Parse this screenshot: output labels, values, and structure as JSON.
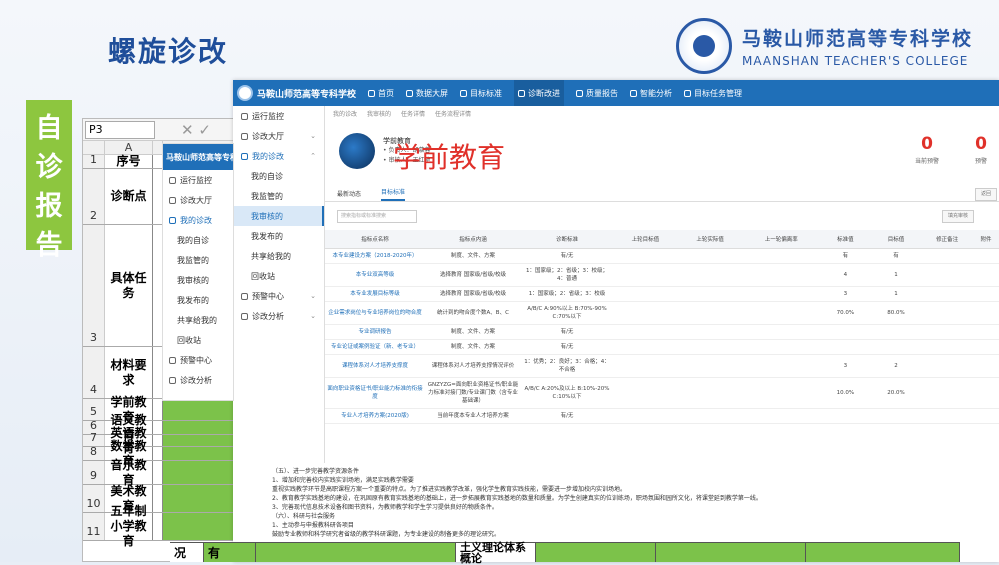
{
  "slide": {
    "title": "螺旋诊改",
    "side_tab": [
      "自",
      "诊",
      "报",
      "告"
    ],
    "college_cn": "马鞍山师范高等专科学校",
    "college_en": "MAANSHAN TEACHER'S COLLEGE"
  },
  "spreadsheet": {
    "cell_ref": "P3",
    "icons": "✕ ✓",
    "col_a": "A",
    "rows": [
      {
        "n": "1",
        "a": "序号",
        "h": 14
      },
      {
        "n": "2",
        "a": "诊断点",
        "h": 56
      },
      {
        "n": "3",
        "a": "具体任务",
        "h": 122
      },
      {
        "n": "4",
        "a": "材料要求",
        "h": 52
      },
      {
        "n": "5",
        "a": "学前教育",
        "h": 22
      },
      {
        "n": "6",
        "a": "语文教育",
        "h": 14
      },
      {
        "n": "7",
        "a": "英语教育",
        "h": 12
      },
      {
        "n": "8",
        "a": "数学教育",
        "h": 14
      },
      {
        "n": "9",
        "a": "音乐教育",
        "h": 24
      },
      {
        "n": "10",
        "a": "美术教育",
        "h": 28
      },
      {
        "n": "11",
        "a": "五年制小学教育",
        "h": 28
      }
    ]
  },
  "app": {
    "brand": "马鞍山师范高等专科学校",
    "nav": [
      "首页",
      "数据大屏",
      "目标标准",
      "诊断改进",
      "质量报告",
      "智能分析",
      "目标任务管理"
    ],
    "nav_active": 3,
    "menu": [
      {
        "type": "item",
        "label": "运行监控",
        "caret": ""
      },
      {
        "type": "item",
        "label": "诊改大厅",
        "caret": "⌄"
      },
      {
        "type": "item",
        "label": "我的诊改",
        "caret": "⌃",
        "open": true
      },
      {
        "type": "sub",
        "label": "我的自诊"
      },
      {
        "type": "sub",
        "label": "我监管的"
      },
      {
        "type": "sub",
        "label": "我审核的",
        "sel": true
      },
      {
        "type": "sub",
        "label": "我发布的"
      },
      {
        "type": "sub",
        "label": "共享给我的"
      },
      {
        "type": "sub",
        "label": "回收站"
      },
      {
        "type": "item",
        "label": "预警中心",
        "caret": "⌄"
      },
      {
        "type": "item",
        "label": "诊改分析",
        "caret": "⌄"
      }
    ],
    "overlay_menu": [
      {
        "type": "item",
        "label": "运行监控"
      },
      {
        "type": "item",
        "label": "诊改大厅"
      },
      {
        "type": "item",
        "label": "我的诊改",
        "open": true
      },
      {
        "type": "sub",
        "label": "我的自诊"
      },
      {
        "type": "sub",
        "label": "我监管的"
      },
      {
        "type": "sub",
        "label": "我审核的"
      },
      {
        "type": "sub",
        "label": "我发布的"
      },
      {
        "type": "sub",
        "label": "共享给我的"
      },
      {
        "type": "sub",
        "label": "回收站"
      },
      {
        "type": "item",
        "label": "预警中心"
      },
      {
        "type": "item",
        "label": "诊改分析"
      }
    ],
    "breadcrumb": [
      "我的诊改",
      "我审核的",
      "任务详情",
      "任务流程详情"
    ],
    "profile": {
      "name": "学前教育",
      "owner": "• 负责人：胡慕蓉",
      "reviewer": "• 审核人：王红艳"
    },
    "big_title": "学前教育",
    "counters": [
      {
        "num": "0",
        "label": "当前预警"
      },
      {
        "num": "0",
        "label": "预警"
      }
    ],
    "tabs": [
      "最新动态",
      "目标标准"
    ],
    "tab_active": 1,
    "search_placeholder": "搜索指标或标准搜索",
    "btn_export": "填充审核",
    "btn_back": "返回",
    "table": {
      "headers": [
        "指标点名称",
        "指标点内涵",
        "诊断标准",
        "上轮目标值",
        "上轮实际值",
        "上一轮偏离率",
        "标准值",
        "目标值",
        "修正备注",
        "附件"
      ],
      "rows": [
        [
          "本专业建设方案（2018-2020年）",
          "制度、文件、方案",
          "有/无",
          "",
          "",
          "",
          "有",
          "有",
          "",
          ""
        ],
        [
          "本专业双高等级",
          "选择教育 国家级/省级/校级",
          "1：国家级；2：省级；3：校级；4：普通",
          "",
          "",
          "",
          "4",
          "1",
          "",
          ""
        ],
        [
          "本专业发展目标等级",
          "选择教育 国家级/省级/校级",
          "1：国家级；2：省级；3：校级",
          "",
          "",
          "",
          "3",
          "1",
          "",
          ""
        ],
        [
          "企业需求岗位与专业培养岗位的吻合度",
          "统计到的吻合度个数A、B、C",
          "A/B/C A:90%以上 B:70%-90% C:70%以下",
          "",
          "",
          "",
          "70.0%",
          "80.0%",
          "",
          ""
        ],
        [
          "专业调研报告",
          "制度、文件、方案",
          "有/无",
          "",
          "",
          "",
          "",
          "",
          "",
          ""
        ],
        [
          "专业论证或案例验证（新、老专业）",
          "制度、文件、方案",
          "有/无",
          "",
          "",
          "",
          "",
          "",
          "",
          ""
        ],
        [
          "课程体系对人才培养支撑度",
          "课程体系对人才培养支撑情况评价",
          "1：优秀；2：良好；3：合格；4：不合格",
          "",
          "",
          "",
          "3",
          "2",
          "",
          ""
        ],
        [
          "面向职业资格证书/职业能力标准的衔接度",
          "GNZYZG=面向职业资格证书/职业能力标准对接门数/专业课门数（含专业基础课）",
          "A/B/C A:20%及以上 B:10%-20% C:10%以下",
          "",
          "",
          "",
          "10.0%",
          "20.0%",
          "",
          ""
        ],
        [
          "专业人才培养方案(2020版)",
          "当前年度本专业人才培养方案",
          "有/无",
          "",
          "",
          "",
          "",
          "",
          "",
          ""
        ]
      ]
    }
  },
  "doc_text": [
    "（五）、进一步完善教学资源条件",
    "1、增加和完善校内实践实训场地，满足实践教学需要",
    "重视实践教学环节是高职课程方案一个重要的特点。为了推进实践教学改革，强化学生教育实践技能，需要进一步增加校内实训场地。",
    "2、教育教学实践基地的建设，在巩固原有教育实践基地的基础上，进一步拓展教育实践基地的数量和质量。为学生创建真实的位训练场，职场氛围和园所文化，将课堂延到教学第一线。",
    "3、完善现代信息技术设备和图书资料，为教师教学和学生学习提供良好的物质条件。",
    "（六）、科研与社会服务",
    "1、主动参与申报教科研各项目",
    "鼓励专业教师和科学研究者省级的教学科研课题，为专业建设的制备更多的理论研究。"
  ],
  "bottom_strip": [
    "况",
    "有",
    "",
    "土义理论体系概论",
    "",
    "",
    ""
  ],
  "bottom_row12": "五年制小"
}
